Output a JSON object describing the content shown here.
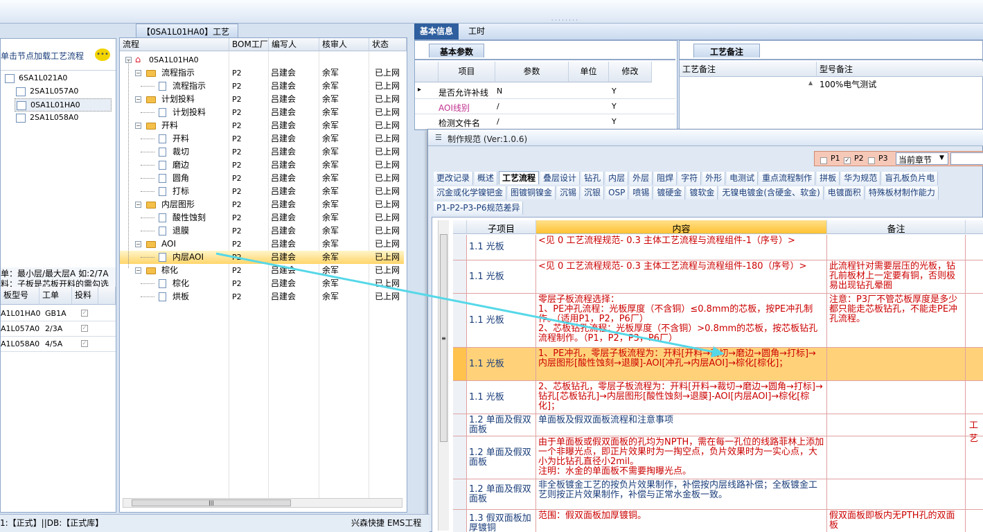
{
  "left_panel": {
    "hint": "单击节点加载工艺流程",
    "tree": [
      "6SA1L021A0",
      "2SA1L057A0",
      "0SA1L01HA0",
      "2SA1L058A0"
    ],
    "note1": "单：最小层/最大层A 如:2/7A",
    "note2": "料：子板是芯板开料的需勾选",
    "table_headers": [
      "板型号",
      "工单",
      "投料"
    ],
    "table_rows": [
      [
        "A1L01HA0",
        "GB1A"
      ],
      [
        "A1L057A0",
        "2/3A"
      ],
      [
        "A1L058A0",
        "4/5A"
      ]
    ]
  },
  "flow_panel": {
    "tab_title": "【0SA1L01HA0】工艺流程",
    "headers": [
      "流程",
      "BOM工厂",
      "编写人",
      "核审人",
      "状态"
    ],
    "root": "0SA1L01HA0",
    "rows": [
      {
        "name": "流程指示",
        "lvl": 1
      },
      {
        "name": "流程指示",
        "lvl": 2
      },
      {
        "name": "计划投料",
        "lvl": 1
      },
      {
        "name": "计划投料",
        "lvl": 2
      },
      {
        "name": "开料",
        "lvl": 1
      },
      {
        "name": "开料",
        "lvl": 2
      },
      {
        "name": "裁切",
        "lvl": 2
      },
      {
        "name": "磨边",
        "lvl": 2
      },
      {
        "name": "圆角",
        "lvl": 2
      },
      {
        "name": "打标",
        "lvl": 2
      },
      {
        "name": "内层图形",
        "lvl": 1
      },
      {
        "name": "酸性蚀刻",
        "lvl": 2
      },
      {
        "name": "退膜",
        "lvl": 2
      },
      {
        "name": "AOI",
        "lvl": 1
      },
      {
        "name": "内层AOI",
        "lvl": 2
      },
      {
        "name": "棕化",
        "lvl": 1
      },
      {
        "name": "棕化",
        "lvl": 2
      },
      {
        "name": "烘板",
        "lvl": 2
      }
    ],
    "bom": "P2",
    "writer": "吕建会",
    "reviewer": "余军",
    "status": "已上网"
  },
  "right_top": {
    "tabs": [
      "基本信息",
      "工时"
    ],
    "subtab": "基本参数",
    "headers": [
      "项目",
      "参数",
      "单位",
      "修改"
    ],
    "rows": [
      [
        "是否允许补线",
        "N",
        "",
        "Y"
      ],
      [
        "AOI线别",
        "/",
        "",
        "Y"
      ],
      [
        "检测文件名",
        "/",
        "",
        "Y"
      ]
    ],
    "remark_tab": "工艺备注",
    "remark_headers": [
      "工艺备注",
      "型号备注"
    ],
    "remark_value": "100%电气测试"
  },
  "spec": {
    "title": "制作规范 (Ver:1.0.6)",
    "p_labels": [
      "P1",
      "P2",
      "P3"
    ],
    "chapter": "当前章节",
    "tabs_row1": [
      "更改记录",
      "概述",
      "工艺流程",
      "叠层设计",
      "钻孔",
      "内层",
      "外层",
      "阻焊",
      "字符",
      "外形",
      "电测试",
      "重点流程制作",
      "拼板",
      "华为规范",
      "盲孔板负片电"
    ],
    "tabs_row2": [
      "沉金或化学镍钯金",
      "图镀铜镍金",
      "沉锡",
      "沉银",
      "OSP",
      "喷锡",
      "镀硬金",
      "镀软金",
      "无镍电镀金(含硬金、软金)",
      "电镀面积",
      "特殊板材制作能力"
    ],
    "tabs_row3": [
      "P1-P2-P3-P6规范差异"
    ],
    "headers": [
      "子项目",
      "内容",
      "备注"
    ],
    "rows": [
      {
        "sub": "1.1 光板",
        "content": "<见 0 工艺流程规范- 0.3 主体工艺流程与流程组件-1（序号）>",
        "remark": ""
      },
      {
        "sub": "1.1 光板",
        "content": "<见 0 工艺流程规范- 0.3 主体工艺流程与流程组件-180（序号）>",
        "remark": "此流程针对需要层压的光板，钻孔前板材上一定要有铜，否则极易出现钻孔晕圈"
      },
      {
        "sub": "1.1 光板",
        "content": "零层子板流程选择：\n1、PE冲孔流程：光板厚度（不含铜）≤0.8mm的芯板，按PE冲孔制作。（适用P1，P2，P6厂）\n2、芯板钻孔流程：光板厚度（不含铜）>0.8mm的芯板，按芯板钻孔流程制作。（P1，P2，P3，P6厂）",
        "remark": "注意：P3厂不管芯板厚度是多少都只能走芯板钻孔，不能走PE冲孔流程。"
      },
      {
        "sub": "1.1 光板",
        "content": "1、PE冲孔，零层子板流程为：开料[开料→裁切→磨边→圆角→打标]→内层图形[酸性蚀刻→退膜]-AOI[冲孔→内层AOI]→棕化[棕化]；",
        "remark": ""
      },
      {
        "sub": "1.1 光板",
        "content": "2、芯板钻孔，零层子板流程为：开料[开料→裁切→磨边→圆角→打标]→钻孔[芯板钻孔]→内层图形[酸性蚀刻→退膜]-AOI[内层AOI]→棕化[棕化]；",
        "remark": ""
      },
      {
        "sub": "1.2 单面及假双面板",
        "content": "单面板及假双面板流程和注意事项",
        "remark": ""
      },
      {
        "sub": "1.2 单面及假双面板",
        "content": "由于单面板或假双面板的孔均为NPTH，需在每一孔位的线路菲林上添加一个非曝光点，即正片效果时为一掏空点，负片效果时为一实心点，大小为比钻孔直径小2mil。\n注明：水金的单面板不需要掏曝光点。",
        "remark": ""
      },
      {
        "sub": "1.2 单面及假双面板",
        "content": "非全板镀金工艺的按负片效果制作，补偿按内层线路补偿；全板镀金工艺则按正片效果制作，补偿与正常水金板一致。",
        "remark": ""
      },
      {
        "sub": "1.3 假双面板加厚镀铜",
        "content": "范围：假双面板加厚镀铜。",
        "remark": "假双面板即板内无PTH孔的双面板"
      }
    ],
    "edge_text": "工艺"
  },
  "status_bar": {
    "left": "1:【正式】||DB:【正式库】",
    "right": "兴森快捷 EMS工程系"
  }
}
